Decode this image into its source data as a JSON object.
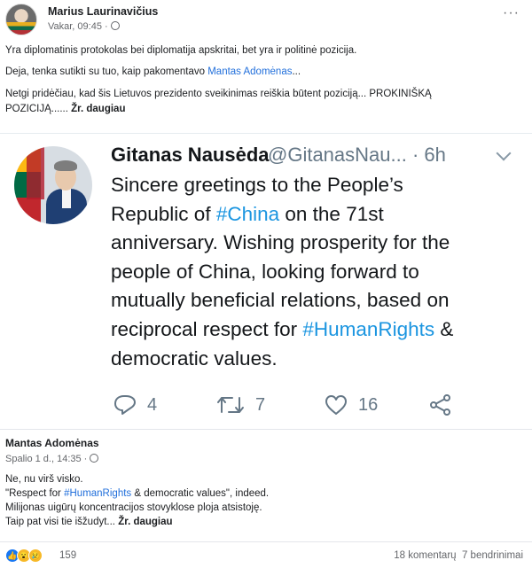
{
  "post": {
    "author": "Marius Laurinavičius",
    "time": "Vakar, 09:45",
    "more": "···",
    "line1": "Yra diplomatinis protokolas bei diplomatija apskritai, bet yra ir politinė pozicija.",
    "line2_prefix": "Deja, tenka sutikti su tuo, kaip pakomentavo ",
    "line2_link": "Mantas Adomėnas",
    "line2_suffix": "...",
    "line3": "Netgi pridėčiau, kad šis Lietuvos prezidento sveikinimas reiškia būtent poziciją... PROKINIŠKĄ",
    "line4_prefix": "POZICIJĄ...... ",
    "see_more": "Žr. daugiau"
  },
  "tweet": {
    "name": "Gitanas Nausėda",
    "handle": "@GitanasNau... · 6h",
    "lines": [
      {
        "pre": "Sincere greetings to the People’s",
        "tag": "",
        "post": ""
      },
      {
        "pre": "Republic of ",
        "tag": "#China",
        "post": " on the 71st"
      },
      {
        "pre": "anniversary. Wishing prosperity for the",
        "tag": "",
        "post": ""
      },
      {
        "pre": "people of China, looking forward to",
        "tag": "",
        "post": ""
      },
      {
        "pre": "mutually beneficial relations, based on",
        "tag": "",
        "post": ""
      },
      {
        "pre": "reciprocal respect for ",
        "tag": "#HumanRights",
        "post": " &"
      },
      {
        "pre": "democratic values.",
        "tag": "",
        "post": ""
      }
    ],
    "replies": "4",
    "retweets": "7",
    "likes": "16",
    "icons": {
      "reply": "reply-icon",
      "retweet": "retweet-icon",
      "like": "heart-icon",
      "share": "share-icon"
    },
    "hashtag_color": "#1b95e0"
  },
  "comment": {
    "author": "Mantas Adomėnas",
    "time": "Spalio 1 d., 14:35",
    "line1": "Ne, nu virš visko.",
    "line2_prefix": "\"Respect for ",
    "line2_tag": "#HumanRights",
    "line2_suffix": " & democratic values\", indeed.",
    "line3": "Milijonas uigūrų koncentracijos stovyklose ploja atsistoję.",
    "line4_prefix": "Taip pat visi tie išžudyt... ",
    "see_more": "Žr. daugiau"
  },
  "footer": {
    "reactions_count": "159",
    "comments": "18 komentarų",
    "shares": "7 bendrinimai"
  },
  "colors": {
    "link": "#216fdb",
    "twitter_gray": "#657786"
  }
}
